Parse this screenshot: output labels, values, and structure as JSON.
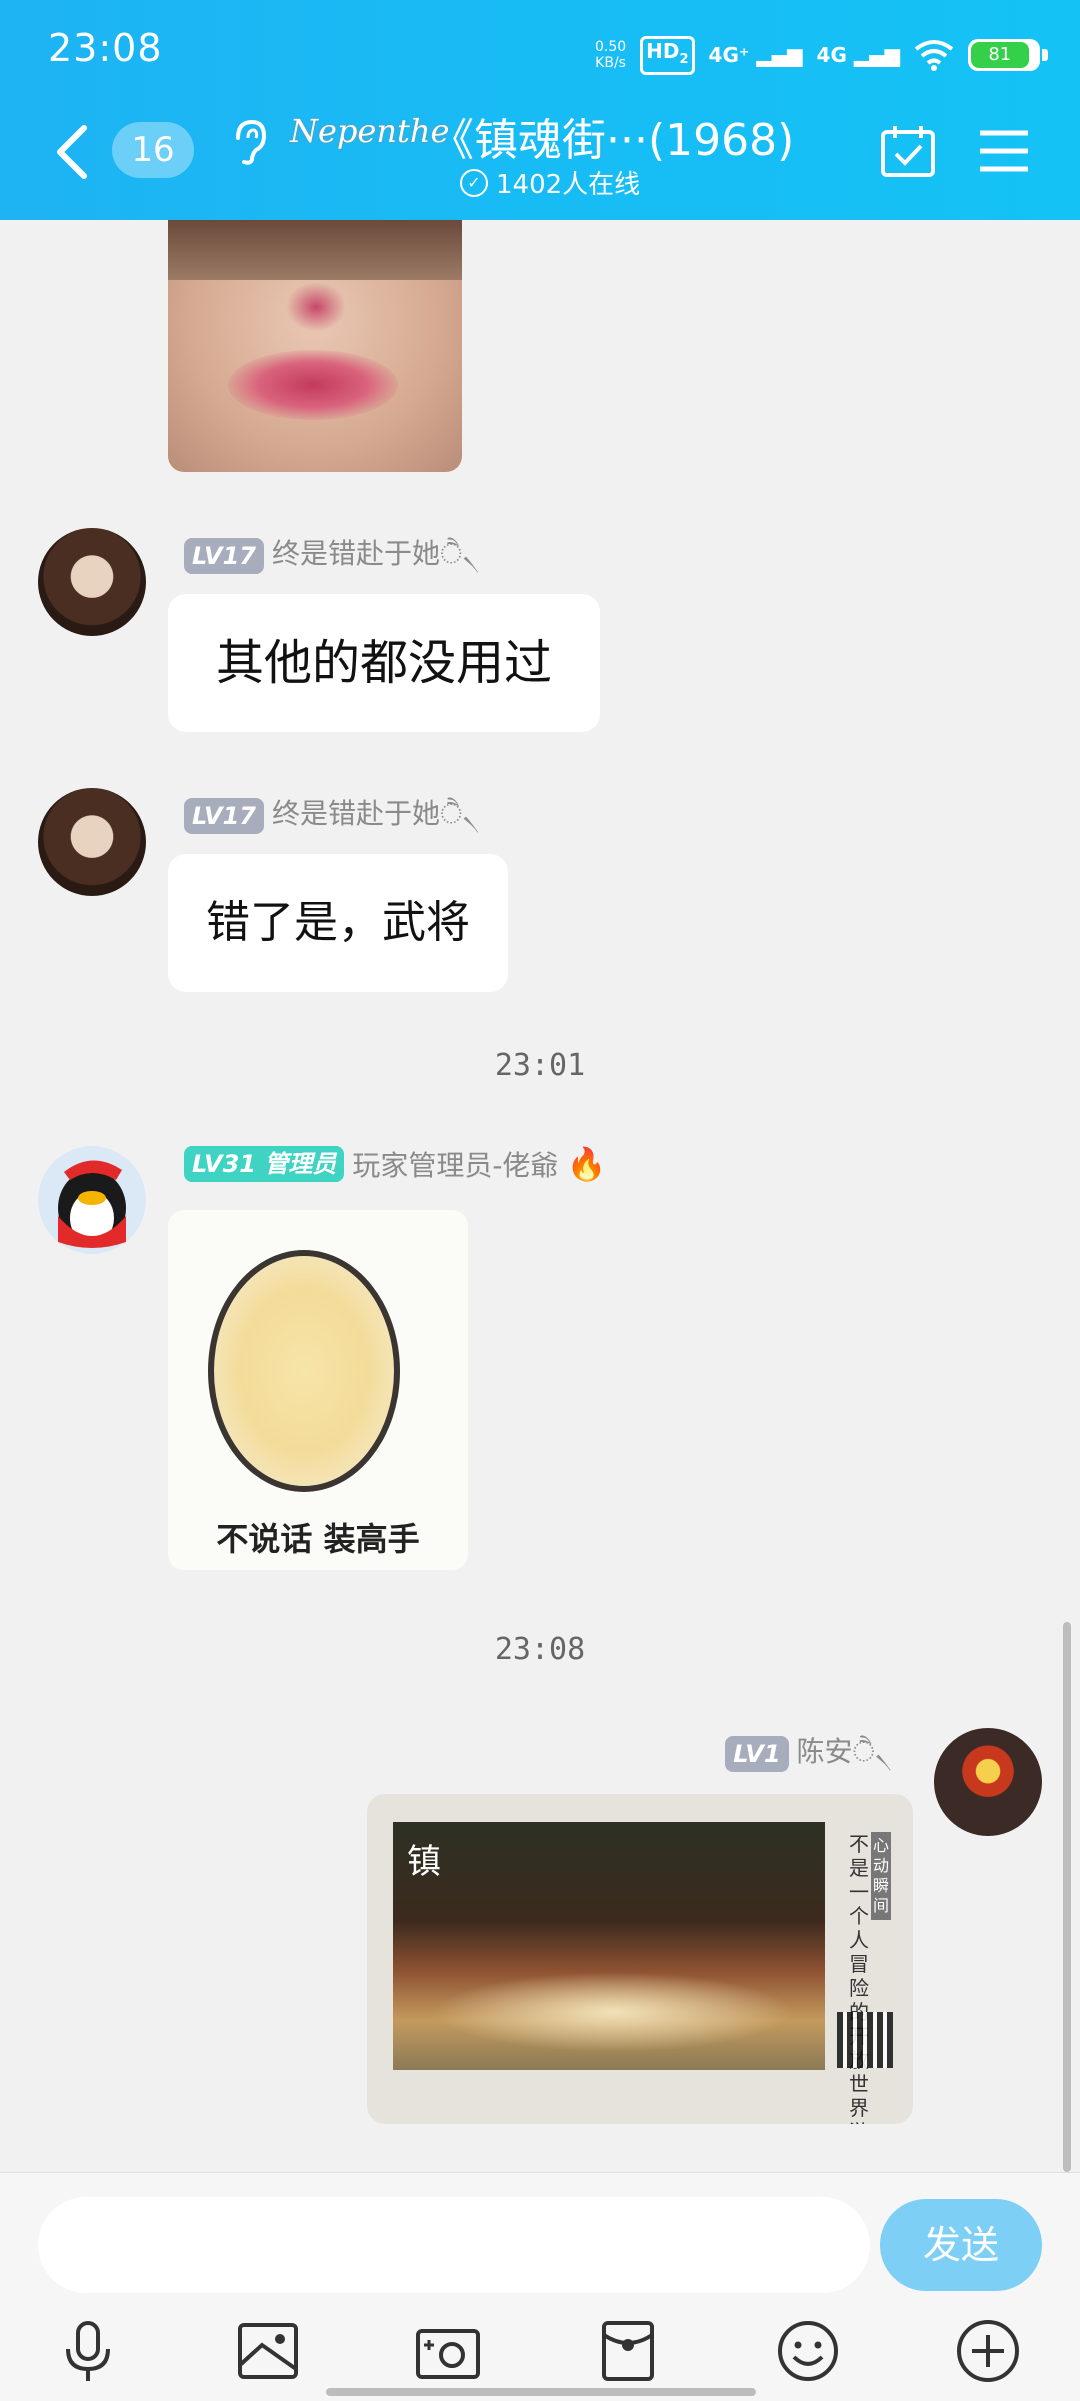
{
  "status_bar": {
    "time": "23:08",
    "net_speed_value": "0.50",
    "net_speed_unit": "KB/s",
    "hd_label": "HD",
    "hd_sub": "2",
    "sim1": "4G⁺",
    "sim2": "4G",
    "battery": "81"
  },
  "header": {
    "unread_count": "16",
    "logo_text": "Nepenthe",
    "title": "《镇魂街···(1968)",
    "online": "1402人在线",
    "icons": [
      "back-icon",
      "ear-icon",
      "calendar-check-icon",
      "menu-icon"
    ]
  },
  "messages": [
    {
      "level": "LV17",
      "nick": "终是错赴于她ੈ৲"
    },
    {
      "text": "其他的都没用过"
    },
    {
      "level": "LV17",
      "nick": "终是错赴于她ੈ৲"
    },
    {
      "text": "错了是，武将"
    },
    {
      "level": "LV31",
      "role": "管理员",
      "nick": "玩家管理员-佬爺",
      "emoji": "🔥"
    },
    {
      "sticker_caption": "不说话 装高手"
    },
    {
      "level": "LV1",
      "nick": "陈安ੈ৲"
    },
    {
      "card_text": "不是一个人冒险的开放世界游戏",
      "card_tag": "心动瞬间",
      "card_logo": "镇"
    }
  ],
  "timestamps": [
    "23:01",
    "23:08"
  ],
  "input": {
    "placeholder": "",
    "send_label": "发送",
    "tools": [
      "mic-icon",
      "image-icon",
      "camera-icon",
      "red-packet-icon",
      "emoji-icon",
      "plus-icon"
    ]
  },
  "colors": {
    "header": "#18bcf5",
    "send_button": "#7dcff5",
    "admin_badge": "#3ed3c2",
    "level_badge": "#a8adbd"
  }
}
